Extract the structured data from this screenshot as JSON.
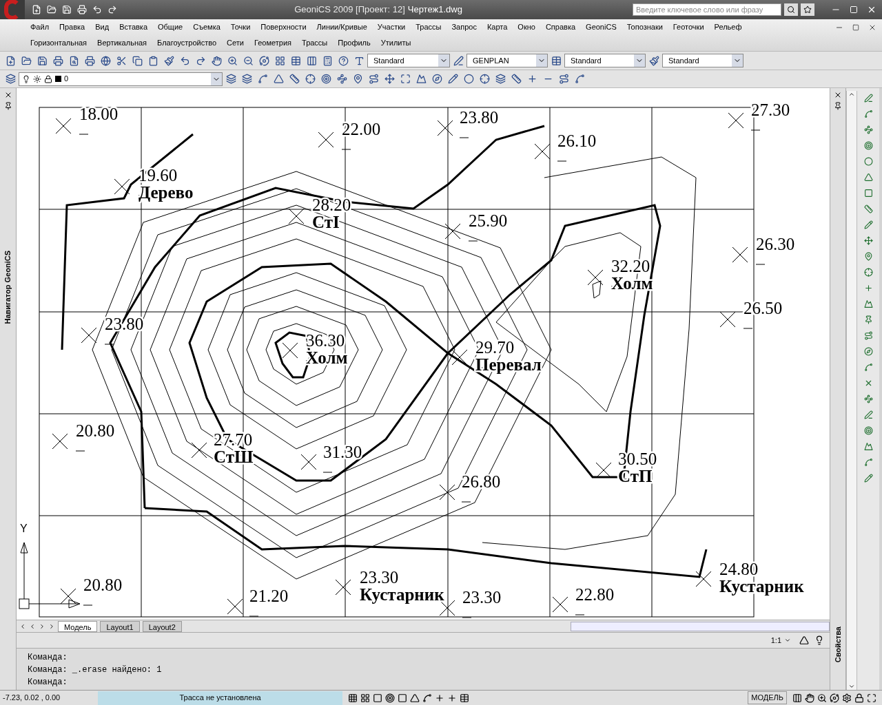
{
  "title_bar": {
    "app_title": "GeoniCS 2009 [Проект: 12]",
    "file_name": "Чертеж1.dwg",
    "search_placeholder": "Введите ключевое слово или фразу"
  },
  "menu_rows": [
    [
      "Файл",
      "Правка",
      "Вид",
      "Вставка",
      "Общие",
      "Съемка",
      "Точки",
      "Поверхности",
      "Линии/Кривые",
      "Участки",
      "Трассы",
      "Запрос",
      "Карта",
      "Окно",
      "Справка",
      "GeoniCS",
      "Топознаки",
      "Геоточки",
      "Рельеф"
    ],
    [
      "Горизонтальная",
      "Вертикальная",
      "Благоустройство",
      "Сети",
      "Геометрия",
      "Трассы",
      "Профиль",
      "Утилиты"
    ]
  ],
  "style_dropdowns": [
    {
      "value": "Standard"
    },
    {
      "value": "GENPLAN"
    },
    {
      "value": "Standard"
    },
    {
      "value": "Standard"
    }
  ],
  "layer_dropdown": {
    "value": "0"
  },
  "navigator_panel": {
    "title": "Навигатор GeoniCS"
  },
  "drawing": {
    "points": [
      {
        "elevation": "18.00"
      },
      {
        "elevation": "22.00"
      },
      {
        "elevation": "23.80"
      },
      {
        "elevation": "26.10"
      },
      {
        "elevation": "27.30"
      },
      {
        "elevation": "19.60",
        "name": "Дерево"
      },
      {
        "elevation": "28.20",
        "name": "СтI"
      },
      {
        "elevation": "25.90"
      },
      {
        "elevation": "26.30"
      },
      {
        "elevation": "23.80"
      },
      {
        "elevation": "36.30",
        "name": "Холм"
      },
      {
        "elevation": "29.70",
        "name": "Перевал"
      },
      {
        "elevation": "32.20",
        "name": "Холм"
      },
      {
        "elevation": "26.50"
      },
      {
        "elevation": "20.80"
      },
      {
        "elevation": "27.70",
        "name": "СтШ"
      },
      {
        "elevation": "31.30"
      },
      {
        "elevation": "26.80"
      },
      {
        "elevation": "30.50",
        "name": "СтП"
      },
      {
        "elevation": "20.80"
      },
      {
        "elevation": "21.20"
      },
      {
        "elevation": "23.30",
        "name": "Кустарник"
      },
      {
        "elevation": "23.30"
      },
      {
        "elevation": "22.80"
      },
      {
        "elevation": "24.80",
        "name": "Кустарник"
      }
    ],
    "ucs_axis_label": "Y"
  },
  "layout_tabs": [
    {
      "label": "Модель",
      "selected": true
    },
    {
      "label": "Layout1",
      "selected": false
    },
    {
      "label": "Layout2",
      "selected": false
    }
  ],
  "annotation_scale": "1:1",
  "properties_panel": {
    "title": "Свойства"
  },
  "command_history": [
    "Команда:",
    "Команда: _.erase найдено: 1"
  ],
  "command_prompt": "Команда:",
  "status_bar": {
    "coordinates": "-7.23, 0.02 , 0.00",
    "trace_status": "Трасса не установлена",
    "space": "МОДЕЛЬ"
  }
}
